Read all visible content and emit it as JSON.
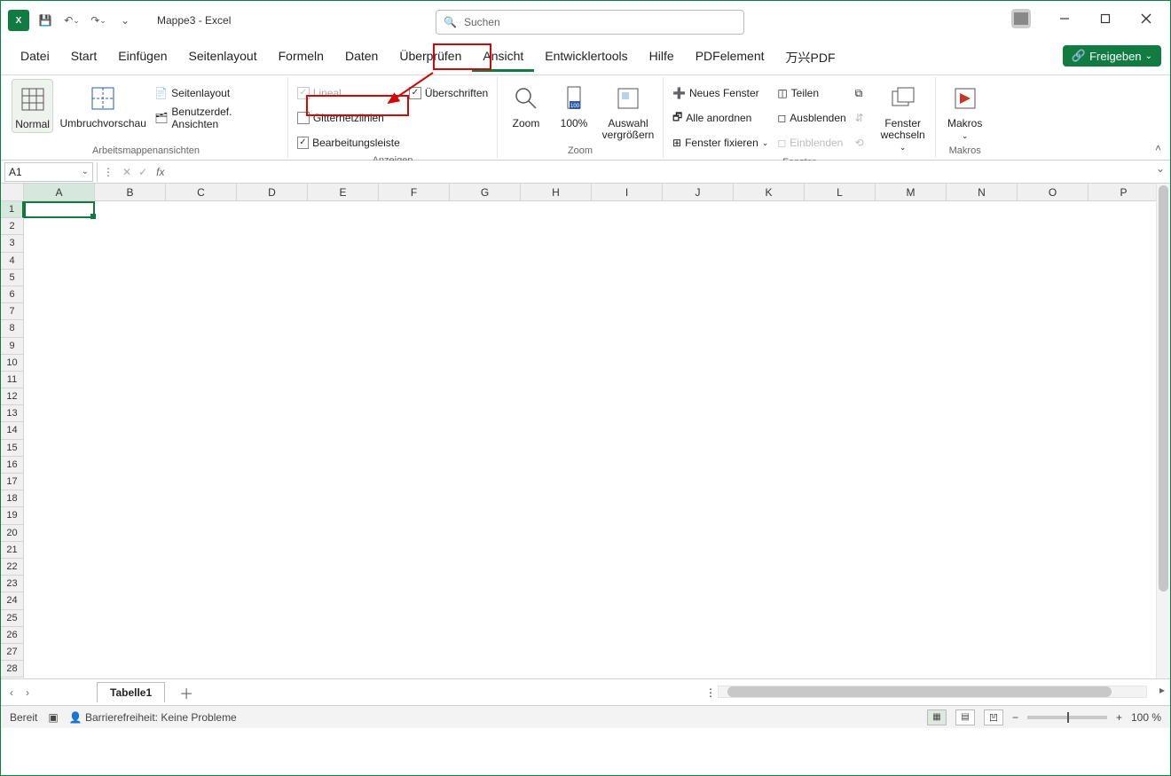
{
  "window": {
    "title": "Mappe3  -  Excel"
  },
  "qat": {
    "save": "💾",
    "undo": "↶",
    "redo": "↷",
    "more": "⌄"
  },
  "search": {
    "placeholder": "Suchen"
  },
  "tabs": {
    "items": [
      "Datei",
      "Start",
      "Einfügen",
      "Seitenlayout",
      "Formeln",
      "Daten",
      "Überprüfen",
      "Ansicht",
      "Entwicklertools",
      "Hilfe",
      "PDFelement",
      "万兴PDF"
    ],
    "active": "Ansicht",
    "share": "Freigeben"
  },
  "ribbon": {
    "group_views": {
      "normal": "Normal",
      "pagebreak": "Umbruchvorschau",
      "layout": "Seitenlayout",
      "custom": "Benutzerdef. Ansichten",
      "label": "Arbeitsmappenansichten"
    },
    "group_show": {
      "ruler": "Lineal",
      "gridlines": "Gitternetzlinien",
      "formula": "Bearbeitungsleiste",
      "headings": "Überschriften",
      "label": "Anzeigen"
    },
    "group_zoom": {
      "zoom": "Zoom",
      "hundred": "100%",
      "selection_l1": "Auswahl",
      "selection_l2": "vergrößern",
      "label": "Zoom"
    },
    "group_window": {
      "new": "Neues Fenster",
      "arrange": "Alle anordnen",
      "freeze": "Fenster fixieren",
      "split": "Teilen",
      "hide": "Ausblenden",
      "unhide": "Einblenden",
      "label": "Fenster"
    },
    "group_switch": {
      "switch_l1": "Fenster",
      "switch_l2": "wechseln"
    },
    "group_macros": {
      "macros": "Makros",
      "label": "Makros"
    }
  },
  "namebox": {
    "value": "A1"
  },
  "grid": {
    "cols": [
      "A",
      "B",
      "C",
      "D",
      "E",
      "F",
      "G",
      "H",
      "I",
      "J",
      "K",
      "L",
      "M",
      "N",
      "O",
      "P"
    ],
    "rows": [
      1,
      2,
      3,
      4,
      5,
      6,
      7,
      8,
      9,
      10,
      11,
      12,
      13,
      14,
      15,
      16,
      17,
      18,
      19,
      20,
      21,
      22,
      23,
      24,
      25,
      26,
      27,
      28
    ]
  },
  "sheets": {
    "active": "Tabelle1"
  },
  "status": {
    "ready": "Bereit",
    "acc": "Barrierefreiheit: Keine Probleme",
    "zoom": "100 %"
  }
}
